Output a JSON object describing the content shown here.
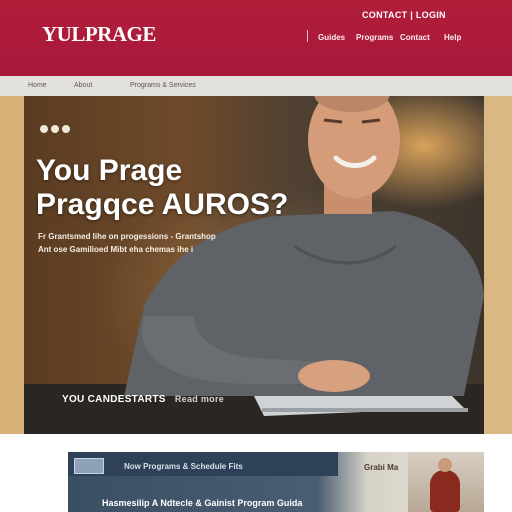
{
  "header": {
    "logo": "YULPRAGE",
    "top_links": "CONTACT | LOGIN",
    "nav": [
      "Guides",
      "Programs",
      "Contact",
      "Help"
    ]
  },
  "subnav": [
    "Home",
    "About",
    "Programs & Services"
  ],
  "hero": {
    "title_line1": "You Prage",
    "title_line2": "Pragqce AUROS?",
    "subtitle_line1": "Fr Grantsmed lihe on progessions - Grantshop",
    "subtitle_line2": "Ant ose Gamilioed Mibt eha chemas ihe i",
    "caption": "YOU CANDESTARTS",
    "caption_more": "Read more"
  },
  "strip": {
    "tag": "Now Programs & Schedule Fits",
    "label": "Grabi Ma",
    "headline": "Hasmesilip A Ndtecle & Gainist Program Guida"
  },
  "colors": {
    "brand_red": "#b01e3a",
    "hero_text": "#ffffff",
    "strip_blue": "#2e4158"
  },
  "icons": [
    "slide-indicator-dots"
  ]
}
